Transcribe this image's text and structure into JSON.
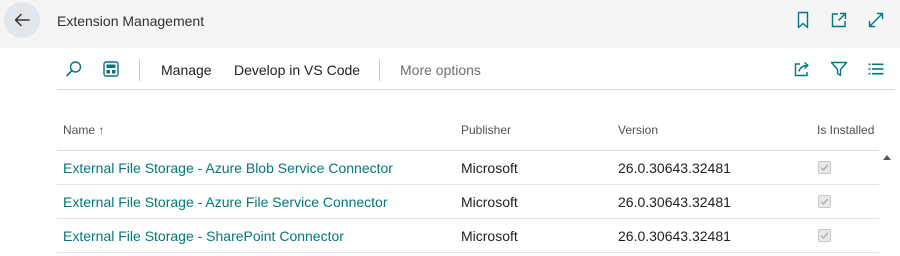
{
  "header": {
    "title": "Extension Management",
    "icons": [
      "back-arrow-icon",
      "bookmark-icon",
      "open-in-new-window-icon",
      "expand-icon"
    ]
  },
  "toolbar": {
    "icons": [
      "search-icon",
      "layout-icon",
      "share-icon",
      "filter-icon",
      "list-view-icon"
    ],
    "manage_label": "Manage",
    "develop_label": "Develop in VS Code",
    "more_label": "More options"
  },
  "table": {
    "columns": [
      {
        "label": "Name",
        "sort": "ascending",
        "sort_icon": "↑"
      },
      {
        "label": "Publisher"
      },
      {
        "label": "Version"
      },
      {
        "label": "Is Installed"
      }
    ],
    "rows": [
      {
        "name": "External File Storage - Azure Blob Service Connector",
        "publisher": "Microsoft",
        "version": "26.0.30643.32481",
        "installed": true
      },
      {
        "name": "External File Storage - Azure File Service Connector",
        "publisher": "Microsoft",
        "version": "26.0.30643.32481",
        "installed": true
      },
      {
        "name": "External File Storage - SharePoint Connector",
        "publisher": "Microsoft",
        "version": "26.0.30643.32481",
        "installed": true
      }
    ]
  },
  "colors": {
    "link": "#00787c",
    "icon": "#00787c",
    "back_button_bg": "#e0e6ea"
  }
}
